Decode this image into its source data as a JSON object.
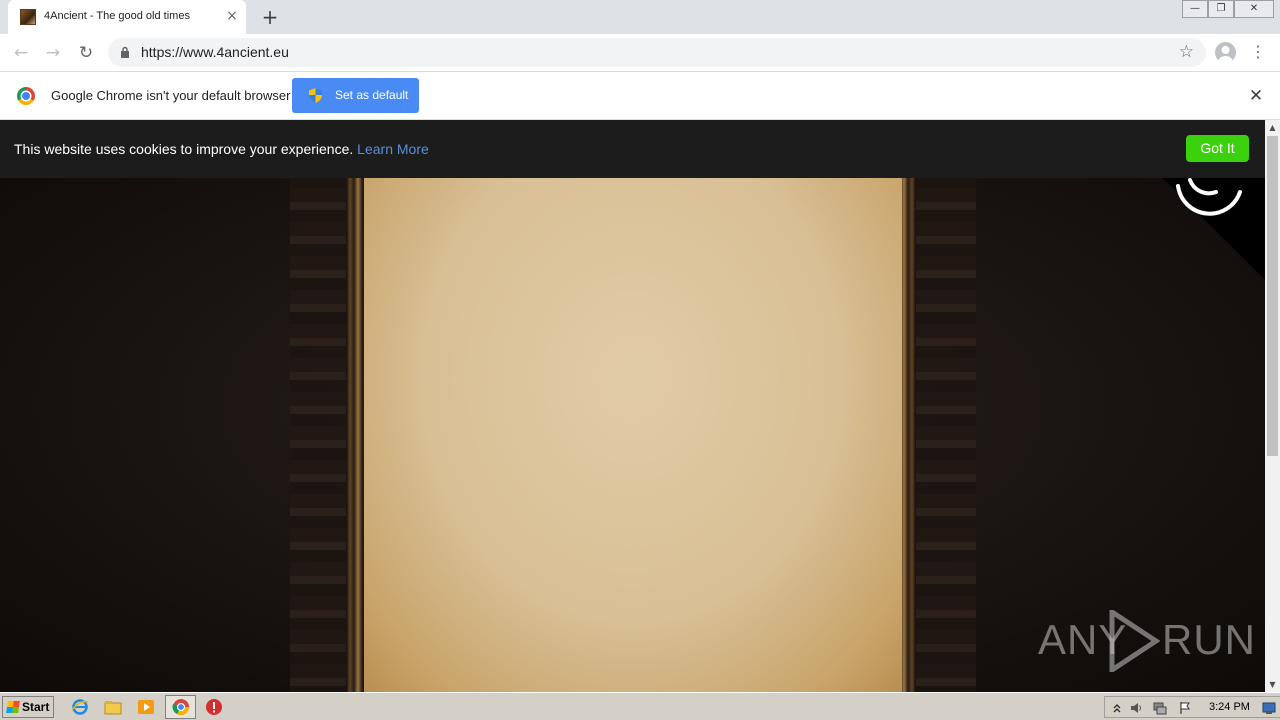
{
  "browser": {
    "tab": {
      "title": "4Ancient - The good old times",
      "close_icon": "×"
    },
    "new_tab_icon": "+",
    "window_controls": {
      "minimize": "—",
      "restore": "❐",
      "close": "✕"
    },
    "nav": {
      "back": "←",
      "forward": "→",
      "reload": "↻"
    },
    "omnibox": {
      "url": "https://www.4ancient.eu",
      "bookmark_icon": "☆"
    },
    "menu_icon": "⋮"
  },
  "infobar": {
    "message": "Google Chrome isn't your default browser",
    "button_label": "Set as default",
    "close_icon": "✕"
  },
  "cookie_bar": {
    "message": "This website uses cookies to improve your experience.",
    "link_label": "Learn More",
    "button_label": "Got It"
  },
  "watermark": {
    "left": "ANY",
    "right": "RUN"
  },
  "scrollbar": {
    "up": "▲",
    "down": "▼"
  },
  "taskbar": {
    "start_label": "Start",
    "clock": "3:24 PM",
    "tray_icons": [
      "up-arrow-icon",
      "speaker-icon",
      "network-icon",
      "flag-icon"
    ]
  },
  "colors": {
    "accent_blue": "#4a8af4",
    "cookie_button": "#3bd10c",
    "link": "#5b8fd6"
  }
}
